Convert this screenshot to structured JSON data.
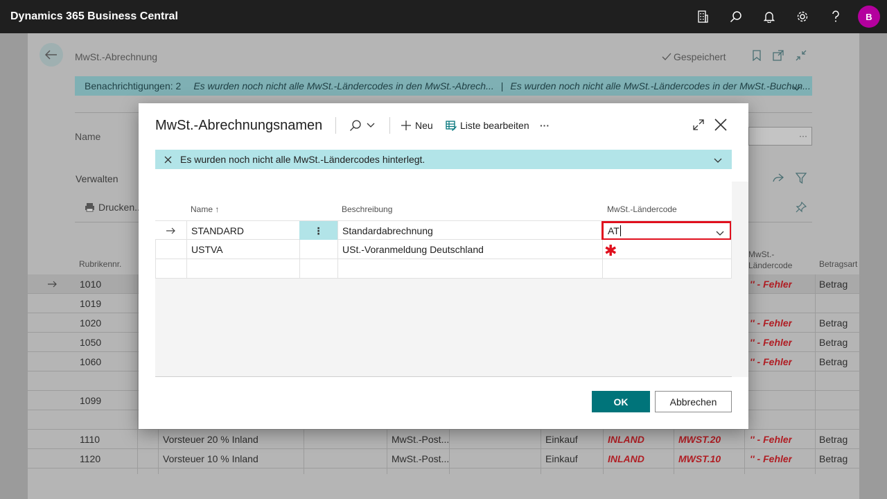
{
  "app": {
    "title": "Dynamics 365 Business Central",
    "avatar_initial": "B",
    "icons": [
      "building-icon",
      "search-icon",
      "bell-icon",
      "gear-icon",
      "help-icon"
    ]
  },
  "background_page": {
    "title": "MwSt.-Abrechnung",
    "saved_label": "Gespeichert",
    "notifications": {
      "label": "Benachrichtigungen: 2",
      "message_1": "Es wurden noch nicht alle MwSt.-Ländercodes in den MwSt.-Abrech...",
      "separator": "|",
      "message_2": "Es wurden noch nicht alle MwSt.-Ländercodes in der MwSt.-Buchun..."
    },
    "name_label": "Name",
    "name_dots": "···",
    "manage_label": "Verwalten",
    "print_label": "Drucken...",
    "columns": {
      "rubrik": "Rubrikennr.",
      "laender_1": "MwSt.-",
      "laender_2": "Ländercode",
      "betragsart": "Betragsart"
    },
    "rows": [
      {
        "nr": "1010",
        "desc": "",
        "type": "",
        "gen": "",
        "bus": "",
        "prod": "",
        "err": "'' - Fehler",
        "amount": "Betrag"
      },
      {
        "nr": "1019",
        "desc": "",
        "type": "",
        "gen": "",
        "bus": "",
        "prod": "",
        "err": "",
        "amount": ""
      },
      {
        "nr": "1020",
        "desc": "",
        "type": "",
        "gen": "",
        "bus": "",
        "prod": "",
        "err": "'' - Fehler",
        "amount": "Betrag"
      },
      {
        "nr": "1050",
        "desc": "",
        "type": "",
        "gen": "",
        "bus": "",
        "prod": "",
        "err": "'' - Fehler",
        "amount": "Betrag"
      },
      {
        "nr": "1060",
        "desc": "",
        "type": "",
        "gen": "",
        "bus": "",
        "prod": "",
        "err": "'' - Fehler",
        "amount": "Betrag"
      },
      {
        "nr": "",
        "desc": "",
        "type": "",
        "gen": "",
        "bus": "",
        "prod": "",
        "err": "",
        "amount": ""
      },
      {
        "nr": "1099",
        "desc": "",
        "type": "",
        "gen": "",
        "bus": "",
        "prod": "",
        "err": "",
        "amount": ""
      },
      {
        "nr": "",
        "desc": "",
        "type": "",
        "gen": "",
        "bus": "",
        "prod": "",
        "err": "",
        "amount": ""
      },
      {
        "nr": "1110",
        "desc": "Vorsteuer 20 % Inland",
        "type": "MwSt.-Post...",
        "gen": "Einkauf",
        "bus": "INLAND",
        "prod": "MWST.20",
        "err": "'' - Fehler",
        "amount": "Betrag"
      },
      {
        "nr": "1120",
        "desc": "Vorsteuer 10 % Inland",
        "type": "MwSt.-Post...",
        "gen": "Einkauf",
        "bus": "INLAND",
        "prod": "MWST.10",
        "err": "'' - Fehler",
        "amount": "Betrag"
      }
    ]
  },
  "dialog": {
    "title": "MwSt.-Abrechnungsnamen",
    "new_label": "Neu",
    "edit_list_label": "Liste bearbeiten",
    "more_label": "···",
    "notice": "Es wurden noch nicht alle MwSt.-Ländercodes hinterlegt.",
    "columns": {
      "name": "Name",
      "sort_indicator": "↑",
      "description": "Beschreibung",
      "country_code": "MwSt.-Ländercode"
    },
    "rows": [
      {
        "name": "STANDARD",
        "description": "Standardabrechnung",
        "country_code": "AT"
      },
      {
        "name": "USTVA",
        "description": "USt.-Voranmeldung Deutschland",
        "required_mark": "✱"
      },
      {
        "name": "",
        "description": "",
        "country_code": ""
      }
    ],
    "ok_label": "OK",
    "cancel_label": "Abbrechen"
  },
  "colors": {
    "topbar": "#1f1f1f",
    "accent": "#00747a",
    "notice_bg": "#b2e4e8",
    "error_red": "#e0101e",
    "avatar": "#b4009e"
  }
}
